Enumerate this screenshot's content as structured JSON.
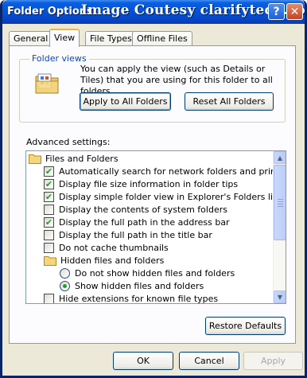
{
  "window": {
    "title": "Folder Options",
    "watermark": "Image Coutesy clarifytech.com",
    "help_glyph": "?",
    "close_glyph": "✕"
  },
  "tabs": [
    {
      "label": "General",
      "active": false
    },
    {
      "label": "View",
      "active": true
    },
    {
      "label": "File Types",
      "active": false
    },
    {
      "label": "Offline Files",
      "active": false
    }
  ],
  "folder_views": {
    "legend": "Folder views",
    "description": "You can apply the view (such as Details or Tiles) that you are using for this folder to all folders.",
    "apply_button": "Apply to All Folders",
    "reset_button": "Reset All Folders",
    "icon": "folder-views-icon"
  },
  "advanced": {
    "label": "Advanced settings:",
    "items": [
      {
        "type": "folder",
        "label": "Files and Folders"
      },
      {
        "type": "checkbox",
        "checked": true,
        "label": "Automatically search for network folders and printers"
      },
      {
        "type": "checkbox",
        "checked": true,
        "label": "Display file size information in folder tips"
      },
      {
        "type": "checkbox",
        "checked": true,
        "label": "Display simple folder view in Explorer's Folders list"
      },
      {
        "type": "checkbox",
        "checked": false,
        "label": "Display the contents of system folders"
      },
      {
        "type": "checkbox",
        "checked": true,
        "label": "Display the full path in the address bar"
      },
      {
        "type": "checkbox",
        "checked": false,
        "label": "Display the full path in the title bar"
      },
      {
        "type": "checkbox",
        "checked": false,
        "label": "Do not cache thumbnails"
      },
      {
        "type": "folder",
        "label": "Hidden files and folders"
      },
      {
        "type": "radio",
        "checked": false,
        "label": "Do not show hidden files and folders"
      },
      {
        "type": "radio",
        "checked": true,
        "label": "Show hidden files and folders"
      },
      {
        "type": "checkbox",
        "checked": false,
        "label": "Hide extensions for known file types"
      }
    ]
  },
  "buttons": {
    "restore_defaults": "Restore Defaults",
    "ok": "OK",
    "cancel": "Cancel",
    "apply": "Apply"
  },
  "colors": {
    "titlebar": "#0553d6",
    "legend": "#0046d5",
    "check": "#21a121"
  }
}
